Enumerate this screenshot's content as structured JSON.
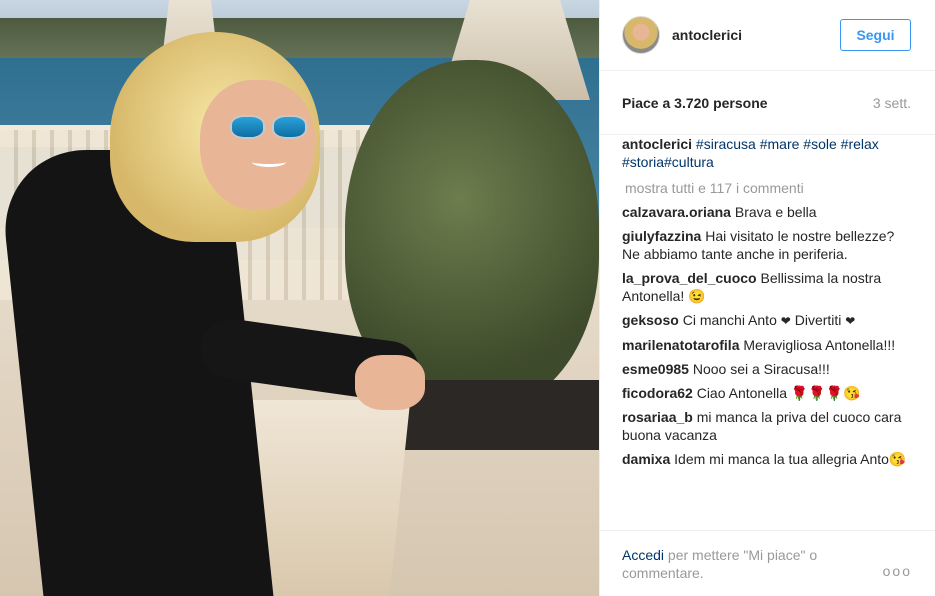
{
  "post": {
    "username": "antoclerici",
    "follow_label": "Segui",
    "likes_text": "Piace a 3.720 persone",
    "time_text": "3 sett.",
    "caption": {
      "username": "antoclerici",
      "text_line1": "#siracusa #mare #sole #relax",
      "text_line2": "#storia#cultura"
    },
    "load_more_text": "mostra tutti e 117 i commenti",
    "comments": [
      {
        "user": "calzavara.oriana",
        "text": "Brava e bella"
      },
      {
        "user": "giulyfazzina",
        "text": "Hai visitato le nostre bellezze? Ne abbiamo tante anche in periferia."
      },
      {
        "user": "la_prova_del_cuoco",
        "text": "Bellissima la nostra Antonella!",
        "emoji": "😉"
      },
      {
        "user": "geksoso",
        "text": "Ci manchi Anto",
        "heart1": "❤",
        "text2": "Divertiti",
        "heart2": "❤"
      },
      {
        "user": "marilenatotarofila",
        "text": "Meravigliosa Antonella!!!"
      },
      {
        "user": "esme0985",
        "text": "Nooo sei a Siracusa!!!"
      },
      {
        "user": "ficodora62",
        "text": "Ciao Antonella",
        "emoji": "🌹🌹🌹😘"
      },
      {
        "user": "rosariaa_b",
        "text": "mi manca la priva del cuoco cara buona vacanza"
      },
      {
        "user": "damixa",
        "text": "Idem mi manca la tua allegria Anto",
        "emoji": "😘"
      }
    ],
    "footer": {
      "login_link": "Accedi",
      "login_text": " per mettere \"Mi piace\" o commentare.",
      "more_label": "ooo"
    }
  },
  "icons": {
    "avatar": "avatar",
    "more": "ellipsis-icon"
  },
  "colors": {
    "link_blue": "#3897f0",
    "hashtag": "#003569",
    "muted": "#999999"
  }
}
